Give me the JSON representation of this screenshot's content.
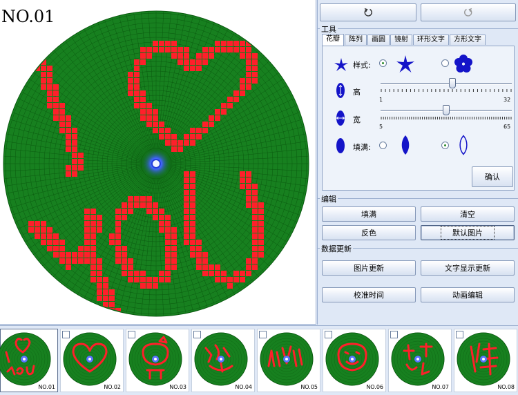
{
  "canvas": {
    "label": "NO.01"
  },
  "toolbar": {
    "rotate_ccw_icon": "rotate-ccw-icon",
    "rotate_cw_icon": "rotate-cw-icon"
  },
  "tools": {
    "title": "工具",
    "tabs": [
      "花瓣",
      "阵列",
      "画圆",
      "镜射",
      "环形文字",
      "方形文字"
    ],
    "active_tab": 0,
    "style_label": "样式:",
    "height_label": "高",
    "width_label": "宽",
    "fill_label": "填满:",
    "height_slider": {
      "min": "1",
      "max": "32",
      "value": 18
    },
    "width_slider": {
      "min": "5",
      "max": "65",
      "value": 35
    },
    "style_selected": 0,
    "fill_selected": 1,
    "confirm_label": "确认"
  },
  "edit": {
    "title": "编辑",
    "fill_label": "填满",
    "clear_label": "清空",
    "invert_label": "反色",
    "default_image_label": "默认图片"
  },
  "data_update": {
    "title": "数据更新",
    "image_update_label": "图片更新",
    "text_display_update_label": "文字显示更新",
    "calibrate_time_label": "校准时间",
    "animation_edit_label": "动画编辑"
  },
  "thumbnails": [
    {
      "label": "NO.01",
      "selected": true
    },
    {
      "label": "NO.02",
      "selected": false
    },
    {
      "label": "NO.03",
      "selected": false
    },
    {
      "label": "NO.04",
      "selected": false
    },
    {
      "label": "NO.05",
      "selected": false
    },
    {
      "label": "NO.06",
      "selected": false
    },
    {
      "label": "NO.07",
      "selected": false
    },
    {
      "label": "NO.08",
      "selected": false
    }
  ],
  "colors": {
    "disc_green": "#17801f",
    "grid_line": "#0b5a10",
    "pixel_red": "#ff1f2a",
    "center_blue": "#2340d8",
    "icon_blue": "#1414c8"
  }
}
